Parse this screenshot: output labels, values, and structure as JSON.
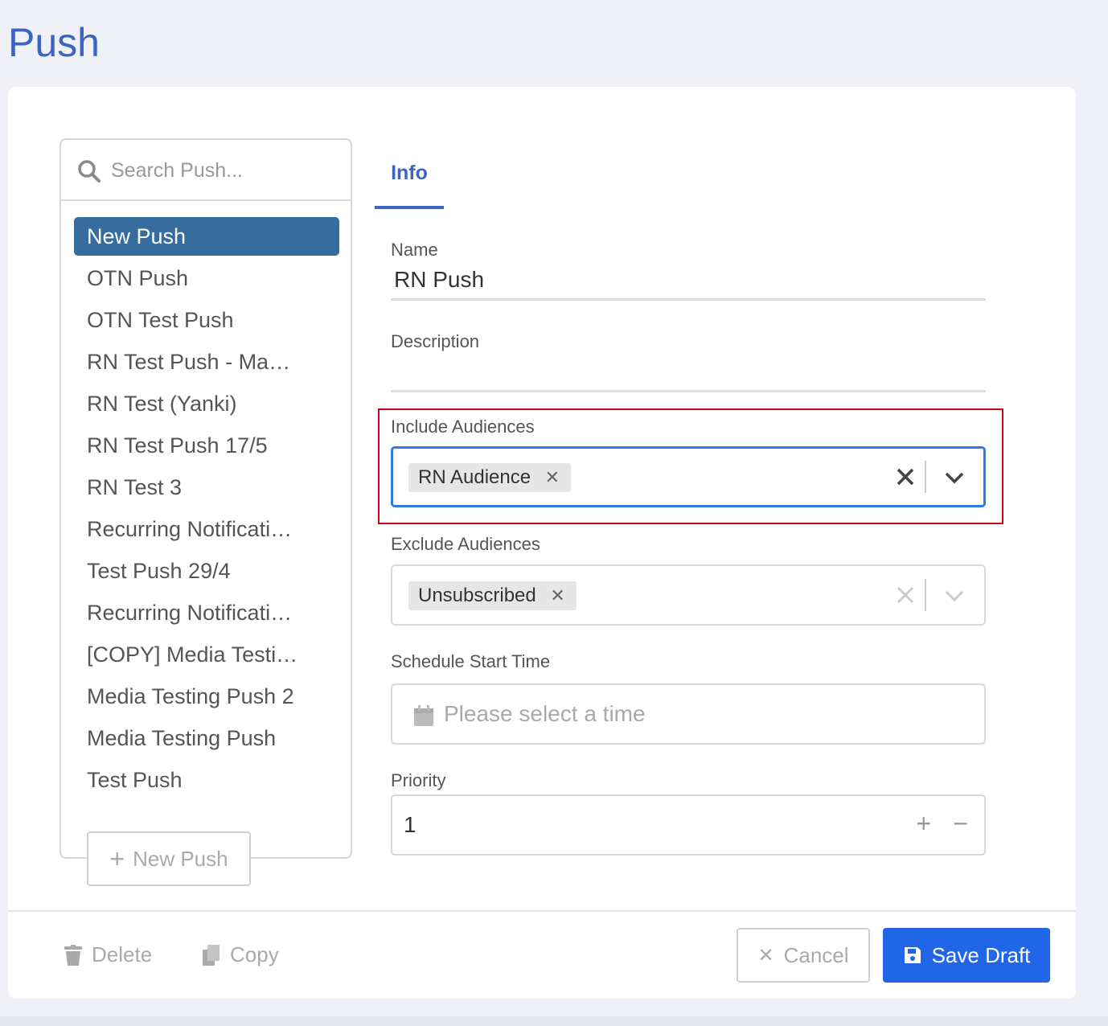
{
  "page": {
    "title": "Push"
  },
  "sidebar": {
    "search_placeholder": "Search Push...",
    "items": [
      {
        "label": "New Push",
        "active": true
      },
      {
        "label": "OTN Push"
      },
      {
        "label": "OTN Test Push"
      },
      {
        "label": "RN Test Push - Ma…"
      },
      {
        "label": "RN Test (Yanki)"
      },
      {
        "label": "RN Test Push 17/5"
      },
      {
        "label": "RN Test 3"
      },
      {
        "label": "Recurring Notificati…"
      },
      {
        "label": "Test Push 29/4"
      },
      {
        "label": "Recurring Notificati…"
      },
      {
        "label": "[COPY] Media Testi…"
      },
      {
        "label": "Media Testing Push 2"
      },
      {
        "label": "Media Testing Push"
      },
      {
        "label": "Test Push"
      }
    ],
    "new_button_label": "New Push"
  },
  "tabs": {
    "info_label": "Info"
  },
  "form": {
    "name_label": "Name",
    "name_value": "RN Push",
    "description_label": "Description",
    "description_value": "",
    "include_label": "Include Audiences",
    "include_chip": "RN Audience",
    "exclude_label": "Exclude Audiences",
    "exclude_chip": "Unsubscribed",
    "schedule_label": "Schedule Start Time",
    "schedule_placeholder": "Please select a time",
    "priority_label": "Priority",
    "priority_value": "1"
  },
  "footer": {
    "delete_label": "Delete",
    "copy_label": "Copy",
    "cancel_label": "Cancel",
    "save_label": "Save Draft"
  },
  "colors": {
    "accent": "#3b64c4",
    "active_item": "#366c9e",
    "primary_button": "#2166e6",
    "highlight_border": "#d0021b",
    "focus_border": "#2e7ae6"
  }
}
